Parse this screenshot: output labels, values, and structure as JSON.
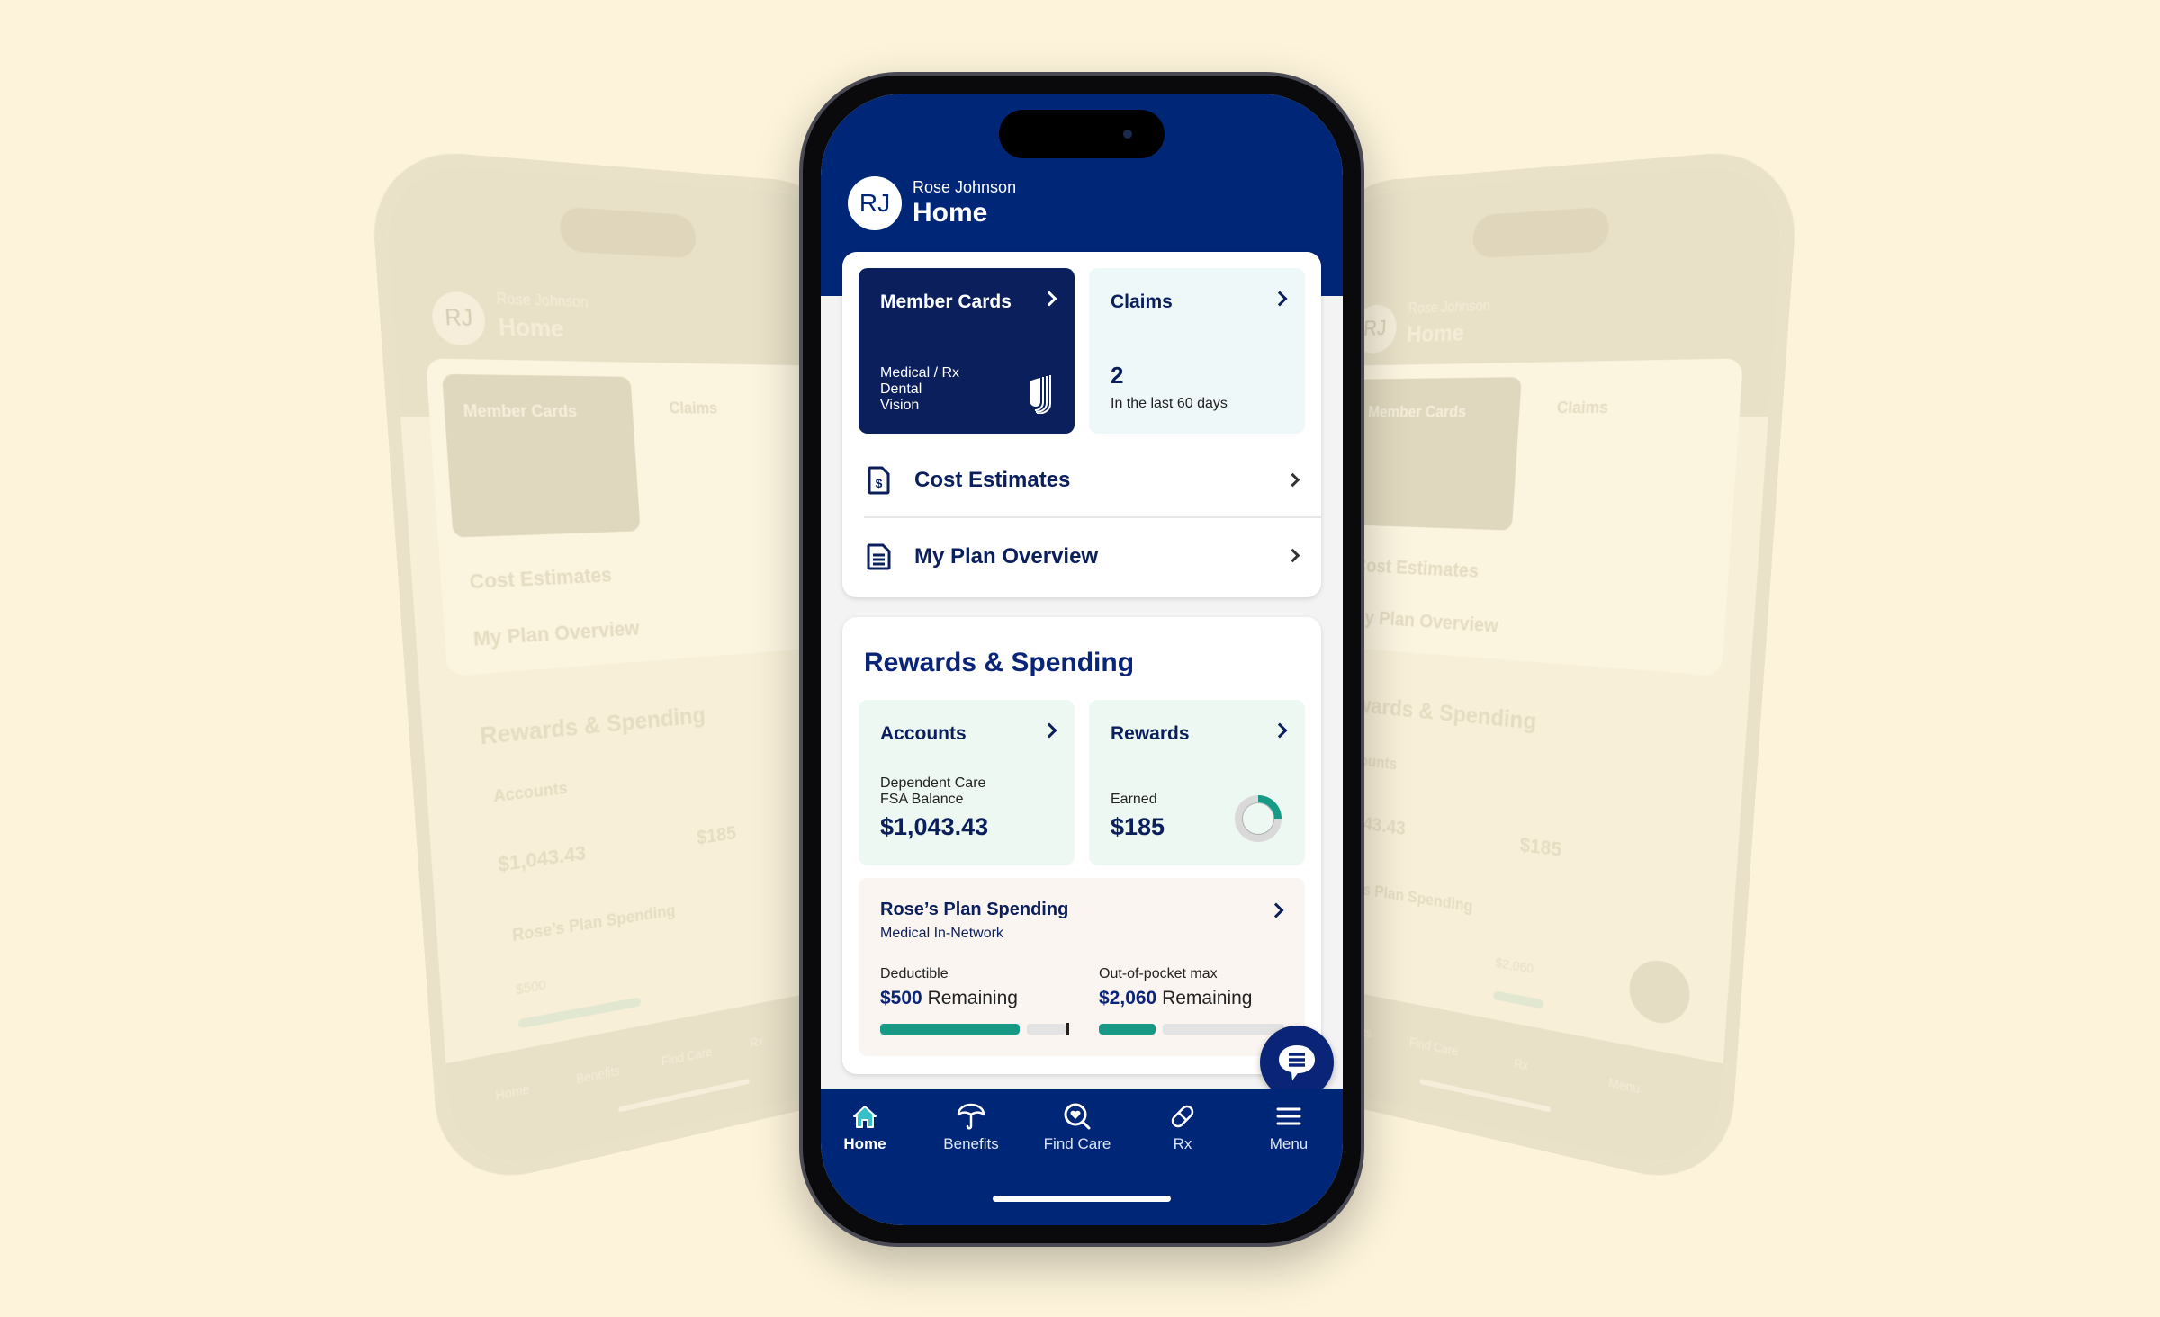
{
  "user": {
    "initials": "RJ",
    "name": "Rose Johnson"
  },
  "header": {
    "title": "Home"
  },
  "quick_tiles": {
    "member_cards": {
      "title": "Member Cards",
      "lines": [
        "Medical / Rx",
        "Dental",
        "Vision"
      ],
      "logo_icon": "uhc-logo-icon"
    },
    "claims": {
      "title": "Claims",
      "count": "2",
      "subtitle": "In the last 60 days"
    }
  },
  "links": [
    {
      "label": "Cost Estimates",
      "icon": "dollar-document-icon"
    },
    {
      "label": "My Plan Overview",
      "icon": "document-icon"
    }
  ],
  "rewards_spending": {
    "title": "Rewards & Spending",
    "accounts": {
      "title": "Accounts",
      "label_line1": "Dependent Care",
      "label_line2": "FSA Balance",
      "value": "$1,043.43"
    },
    "rewards": {
      "title": "Rewards",
      "label": "Earned",
      "value": "$185",
      "progress_fraction": 0.25
    },
    "plan_spending": {
      "title": "Rose’s Plan Spending",
      "subtitle": "Medical In-Network",
      "deductible": {
        "label": "Deductible",
        "amount": "$500",
        "suffix": "Remaining",
        "progress_fraction": 0.74
      },
      "out_of_pocket": {
        "label": "Out-of-pocket max",
        "amount": "$2,060",
        "suffix": "Remaining",
        "progress_fraction": 0.3
      }
    }
  },
  "chat": {
    "icon": "chat-bubble-icon"
  },
  "bottom_nav": [
    {
      "label": "Home",
      "icon": "home-icon",
      "active": true
    },
    {
      "label": "Benefits",
      "icon": "umbrella-icon",
      "active": false
    },
    {
      "label": "Find Care",
      "icon": "search-heart-icon",
      "active": false
    },
    {
      "label": "Rx",
      "icon": "pill-icon",
      "active": false
    },
    {
      "label": "Menu",
      "icon": "menu-icon",
      "active": false
    }
  ],
  "colors": {
    "page_background": "#fcf3da",
    "brand_navy": "#002677",
    "card_navy": "#0a1f5c",
    "accent_teal": "#179a85",
    "claims_tile_bg": "#eef8f8",
    "rewards_tile_bg": "#ecf8f1",
    "plan_tile_bg": "#faf5f1"
  }
}
